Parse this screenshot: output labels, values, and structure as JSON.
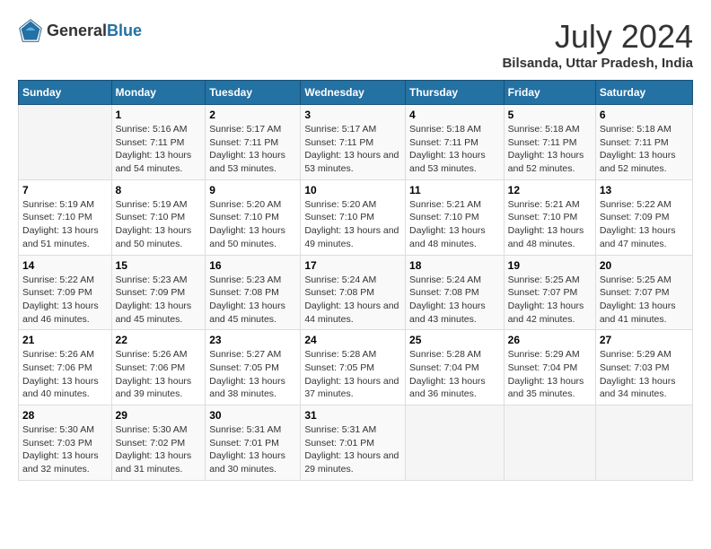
{
  "logo": {
    "text_general": "General",
    "text_blue": "Blue"
  },
  "title": {
    "month_year": "July 2024",
    "location": "Bilsanda, Uttar Pradesh, India"
  },
  "headers": [
    "Sunday",
    "Monday",
    "Tuesday",
    "Wednesday",
    "Thursday",
    "Friday",
    "Saturday"
  ],
  "weeks": [
    [
      {
        "day": "",
        "sunrise": "",
        "sunset": "",
        "daylight": "",
        "empty": true
      },
      {
        "day": "1",
        "sunrise": "Sunrise: 5:16 AM",
        "sunset": "Sunset: 7:11 PM",
        "daylight": "Daylight: 13 hours and 54 minutes."
      },
      {
        "day": "2",
        "sunrise": "Sunrise: 5:17 AM",
        "sunset": "Sunset: 7:11 PM",
        "daylight": "Daylight: 13 hours and 53 minutes."
      },
      {
        "day": "3",
        "sunrise": "Sunrise: 5:17 AM",
        "sunset": "Sunset: 7:11 PM",
        "daylight": "Daylight: 13 hours and 53 minutes."
      },
      {
        "day": "4",
        "sunrise": "Sunrise: 5:18 AM",
        "sunset": "Sunset: 7:11 PM",
        "daylight": "Daylight: 13 hours and 53 minutes."
      },
      {
        "day": "5",
        "sunrise": "Sunrise: 5:18 AM",
        "sunset": "Sunset: 7:11 PM",
        "daylight": "Daylight: 13 hours and 52 minutes."
      },
      {
        "day": "6",
        "sunrise": "Sunrise: 5:18 AM",
        "sunset": "Sunset: 7:11 PM",
        "daylight": "Daylight: 13 hours and 52 minutes."
      }
    ],
    [
      {
        "day": "7",
        "sunrise": "Sunrise: 5:19 AM",
        "sunset": "Sunset: 7:10 PM",
        "daylight": "Daylight: 13 hours and 51 minutes."
      },
      {
        "day": "8",
        "sunrise": "Sunrise: 5:19 AM",
        "sunset": "Sunset: 7:10 PM",
        "daylight": "Daylight: 13 hours and 50 minutes."
      },
      {
        "day": "9",
        "sunrise": "Sunrise: 5:20 AM",
        "sunset": "Sunset: 7:10 PM",
        "daylight": "Daylight: 13 hours and 50 minutes."
      },
      {
        "day": "10",
        "sunrise": "Sunrise: 5:20 AM",
        "sunset": "Sunset: 7:10 PM",
        "daylight": "Daylight: 13 hours and 49 minutes."
      },
      {
        "day": "11",
        "sunrise": "Sunrise: 5:21 AM",
        "sunset": "Sunset: 7:10 PM",
        "daylight": "Daylight: 13 hours and 48 minutes."
      },
      {
        "day": "12",
        "sunrise": "Sunrise: 5:21 AM",
        "sunset": "Sunset: 7:10 PM",
        "daylight": "Daylight: 13 hours and 48 minutes."
      },
      {
        "day": "13",
        "sunrise": "Sunrise: 5:22 AM",
        "sunset": "Sunset: 7:09 PM",
        "daylight": "Daylight: 13 hours and 47 minutes."
      }
    ],
    [
      {
        "day": "14",
        "sunrise": "Sunrise: 5:22 AM",
        "sunset": "Sunset: 7:09 PM",
        "daylight": "Daylight: 13 hours and 46 minutes."
      },
      {
        "day": "15",
        "sunrise": "Sunrise: 5:23 AM",
        "sunset": "Sunset: 7:09 PM",
        "daylight": "Daylight: 13 hours and 45 minutes."
      },
      {
        "day": "16",
        "sunrise": "Sunrise: 5:23 AM",
        "sunset": "Sunset: 7:08 PM",
        "daylight": "Daylight: 13 hours and 45 minutes."
      },
      {
        "day": "17",
        "sunrise": "Sunrise: 5:24 AM",
        "sunset": "Sunset: 7:08 PM",
        "daylight": "Daylight: 13 hours and 44 minutes."
      },
      {
        "day": "18",
        "sunrise": "Sunrise: 5:24 AM",
        "sunset": "Sunset: 7:08 PM",
        "daylight": "Daylight: 13 hours and 43 minutes."
      },
      {
        "day": "19",
        "sunrise": "Sunrise: 5:25 AM",
        "sunset": "Sunset: 7:07 PM",
        "daylight": "Daylight: 13 hours and 42 minutes."
      },
      {
        "day": "20",
        "sunrise": "Sunrise: 5:25 AM",
        "sunset": "Sunset: 7:07 PM",
        "daylight": "Daylight: 13 hours and 41 minutes."
      }
    ],
    [
      {
        "day": "21",
        "sunrise": "Sunrise: 5:26 AM",
        "sunset": "Sunset: 7:06 PM",
        "daylight": "Daylight: 13 hours and 40 minutes."
      },
      {
        "day": "22",
        "sunrise": "Sunrise: 5:26 AM",
        "sunset": "Sunset: 7:06 PM",
        "daylight": "Daylight: 13 hours and 39 minutes."
      },
      {
        "day": "23",
        "sunrise": "Sunrise: 5:27 AM",
        "sunset": "Sunset: 7:05 PM",
        "daylight": "Daylight: 13 hours and 38 minutes."
      },
      {
        "day": "24",
        "sunrise": "Sunrise: 5:28 AM",
        "sunset": "Sunset: 7:05 PM",
        "daylight": "Daylight: 13 hours and 37 minutes."
      },
      {
        "day": "25",
        "sunrise": "Sunrise: 5:28 AM",
        "sunset": "Sunset: 7:04 PM",
        "daylight": "Daylight: 13 hours and 36 minutes."
      },
      {
        "day": "26",
        "sunrise": "Sunrise: 5:29 AM",
        "sunset": "Sunset: 7:04 PM",
        "daylight": "Daylight: 13 hours and 35 minutes."
      },
      {
        "day": "27",
        "sunrise": "Sunrise: 5:29 AM",
        "sunset": "Sunset: 7:03 PM",
        "daylight": "Daylight: 13 hours and 34 minutes."
      }
    ],
    [
      {
        "day": "28",
        "sunrise": "Sunrise: 5:30 AM",
        "sunset": "Sunset: 7:03 PM",
        "daylight": "Daylight: 13 hours and 32 minutes."
      },
      {
        "day": "29",
        "sunrise": "Sunrise: 5:30 AM",
        "sunset": "Sunset: 7:02 PM",
        "daylight": "Daylight: 13 hours and 31 minutes."
      },
      {
        "day": "30",
        "sunrise": "Sunrise: 5:31 AM",
        "sunset": "Sunset: 7:01 PM",
        "daylight": "Daylight: 13 hours and 30 minutes."
      },
      {
        "day": "31",
        "sunrise": "Sunrise: 5:31 AM",
        "sunset": "Sunset: 7:01 PM",
        "daylight": "Daylight: 13 hours and 29 minutes."
      },
      {
        "day": "",
        "sunrise": "",
        "sunset": "",
        "daylight": "",
        "empty": true
      },
      {
        "day": "",
        "sunrise": "",
        "sunset": "",
        "daylight": "",
        "empty": true
      },
      {
        "day": "",
        "sunrise": "",
        "sunset": "",
        "daylight": "",
        "empty": true
      }
    ]
  ]
}
